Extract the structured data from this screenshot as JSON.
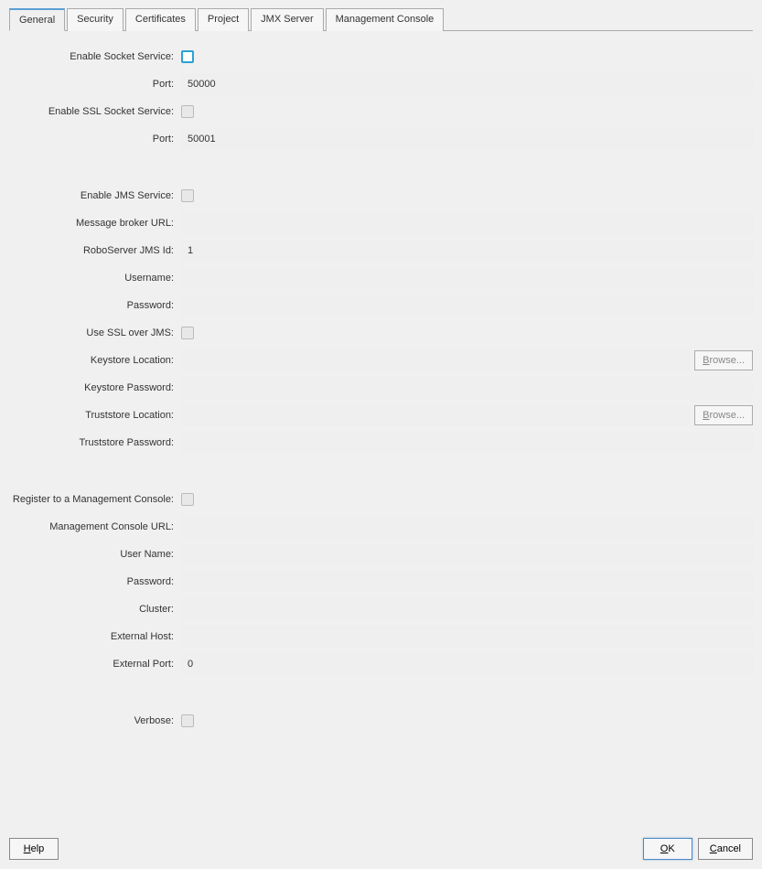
{
  "tabs": [
    "General",
    "Security",
    "Certificates",
    "Project",
    "JMX Server",
    "Management Console"
  ],
  "active_tab": 0,
  "socket": {
    "enable_label": "Enable Socket Service:",
    "port_label": "Port:",
    "port_value": "50000",
    "ssl_enable_label": "Enable SSL Socket Service:",
    "ssl_port_label": "Port:",
    "ssl_port_value": "50001"
  },
  "jms": {
    "enable_label": "Enable JMS Service:",
    "broker_url_label": "Message broker URL:",
    "broker_url_value": "",
    "jms_id_label": "RoboServer JMS Id:",
    "jms_id_value": "1",
    "username_label": "Username:",
    "username_value": "",
    "password_label": "Password:",
    "password_value": "",
    "use_ssl_label": "Use SSL over JMS:",
    "keystore_loc_label": "Keystore Location:",
    "keystore_loc_value": "",
    "keystore_pw_label": "Keystore Password:",
    "keystore_pw_value": "",
    "truststore_loc_label": "Truststore Location:",
    "truststore_loc_value": "",
    "truststore_pw_label": "Truststore Password:",
    "truststore_pw_value": ""
  },
  "mc": {
    "register_label": "Register to a Management Console:",
    "url_label": "Management Console URL:",
    "url_value": "",
    "username_label": "User Name:",
    "username_value": "",
    "password_label": "Password:",
    "password_value": "",
    "cluster_label": "Cluster:",
    "cluster_value": "",
    "ext_host_label": "External Host:",
    "ext_host_value": "",
    "ext_port_label": "External Port:",
    "ext_port_value": "0"
  },
  "verbose_label": "Verbose:",
  "buttons": {
    "browse_prefix": "B",
    "browse_suffix": "rowse...",
    "help_prefix": "H",
    "help_suffix": "elp",
    "ok_prefix": "O",
    "ok_suffix": "K",
    "cancel_prefix": "C",
    "cancel_suffix": "ancel"
  }
}
